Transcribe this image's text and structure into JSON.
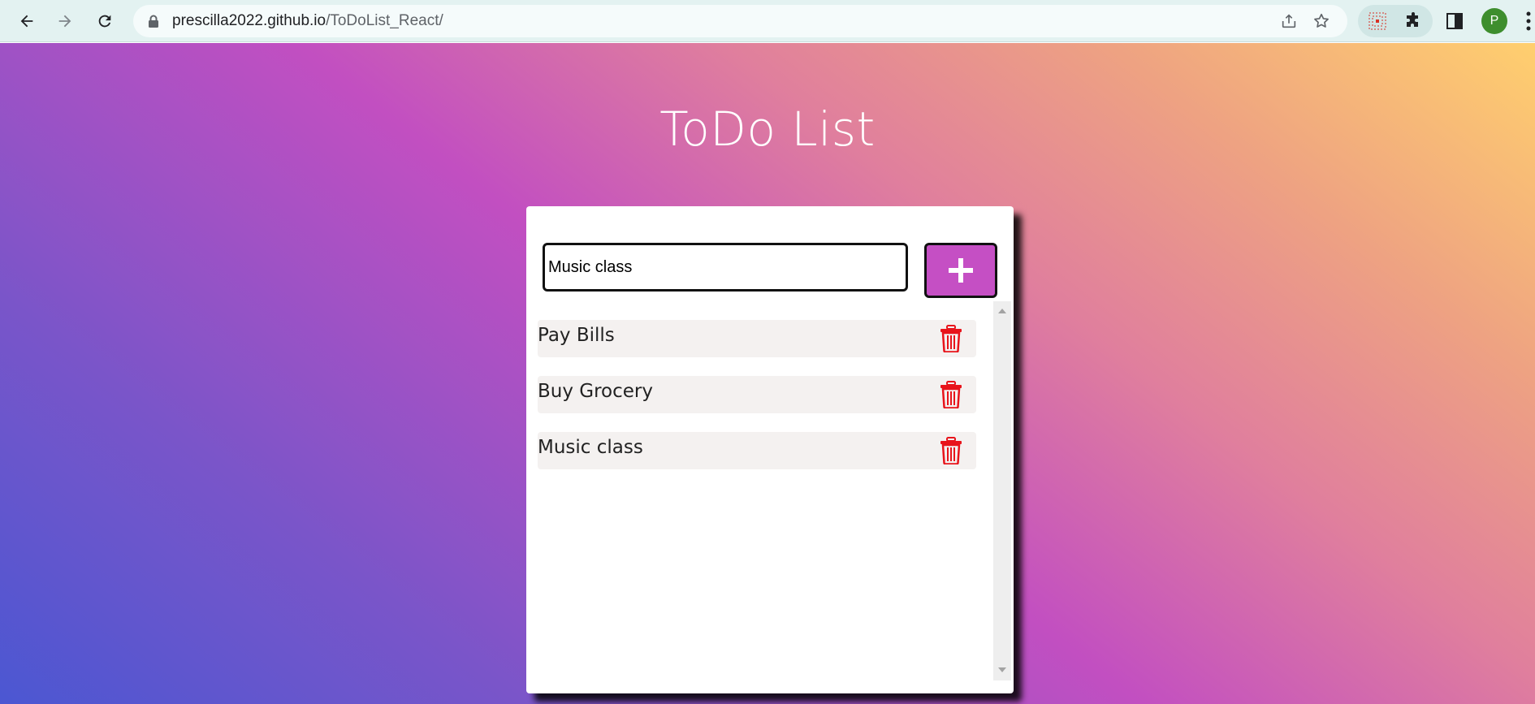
{
  "browser": {
    "url_host": "prescilla2022.github.io",
    "url_path": "/ToDoList_React/",
    "avatar_letter": "P"
  },
  "app": {
    "title": "ToDo List",
    "input": {
      "value": "Music class",
      "placeholder": ""
    },
    "todos": [
      {
        "text": "Pay Bills"
      },
      {
        "text": "Buy Grocery"
      },
      {
        "text": "Music class"
      }
    ]
  },
  "colors": {
    "accent": "#c54fc4",
    "delete": "#e8141b",
    "gradient_start": "#4b57d2",
    "gradient_mid": "#c24fc1",
    "gradient_end": "#ffcf6e"
  },
  "icons": {
    "back": "back-arrow-icon",
    "forward": "forward-arrow-icon",
    "reload": "reload-icon",
    "lock": "lock-icon",
    "share": "share-icon",
    "bookmark": "star-icon",
    "extension": "puzzle-icon",
    "sidepanel": "side-panel-icon",
    "menu": "menu-dots-icon",
    "add": "plus-icon",
    "delete": "trash-icon"
  }
}
